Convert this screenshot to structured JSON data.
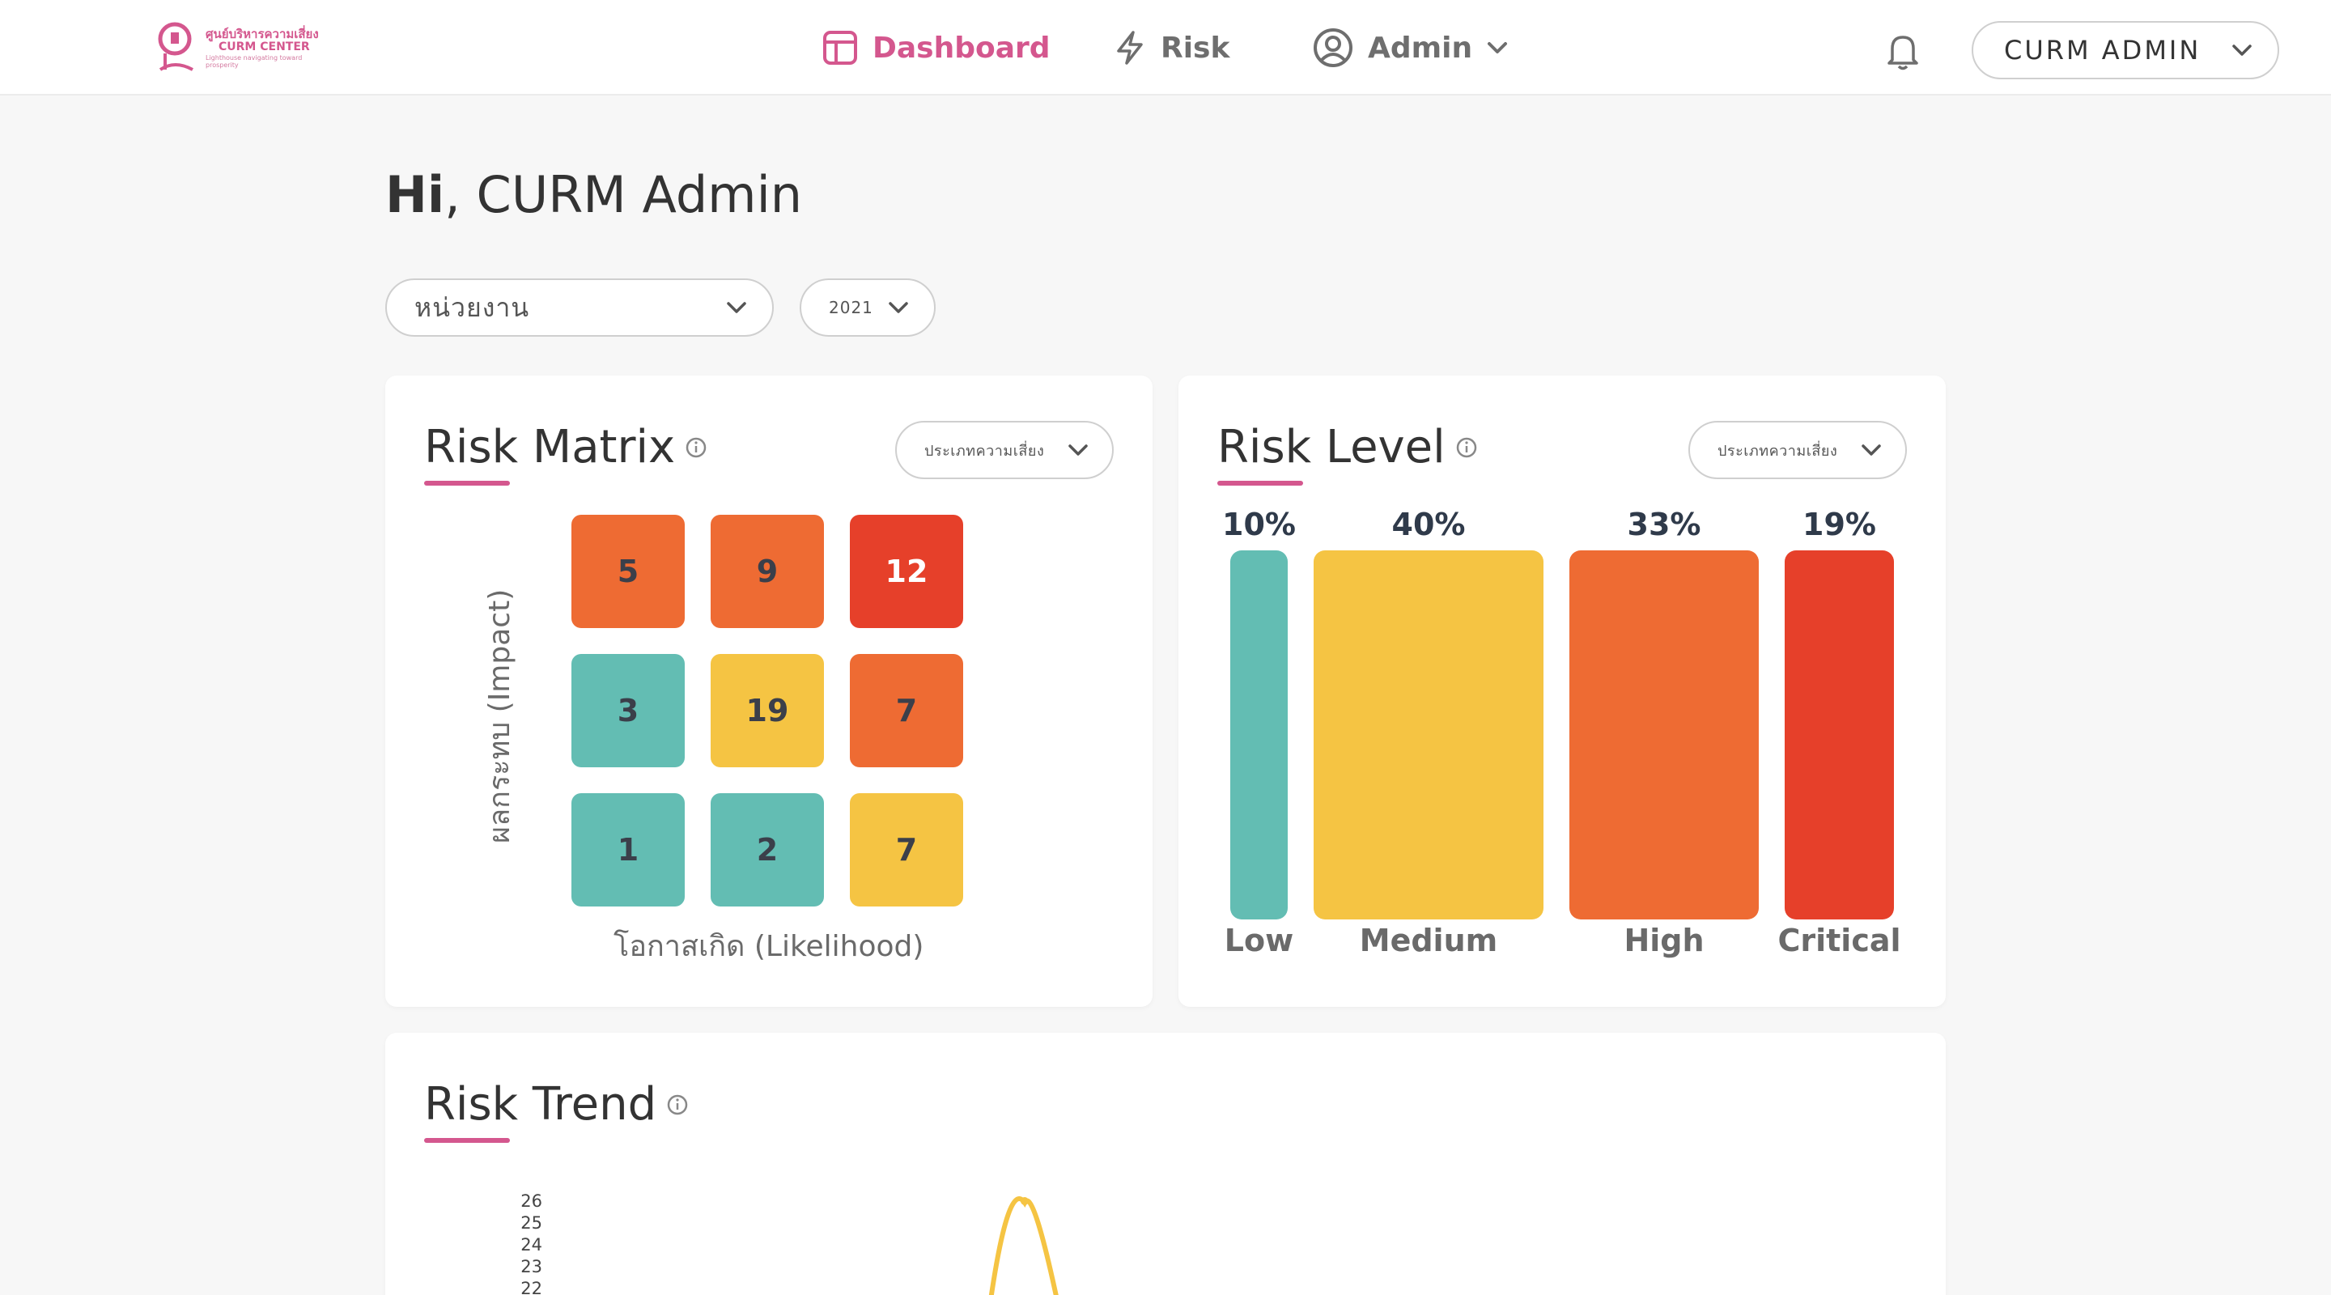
{
  "brand": {
    "logo_line1": "ศูนย์บริหารความเสี่ยง",
    "logo_line2": "CURM CENTER",
    "logo_line3": "Lighthouse navigating toward prosperity"
  },
  "nav": {
    "dashboard": "Dashboard",
    "risk": "Risk",
    "admin": "Admin"
  },
  "user_menu": {
    "label": "CURM ADMIN"
  },
  "greeting": {
    "hi": "Hi",
    "name": ", CURM Admin"
  },
  "filters": {
    "department": "หน่วยงาน",
    "year": "2021"
  },
  "risk_matrix": {
    "title": "Risk Matrix",
    "type_select": "ประเภทความเสี่ยง",
    "y_axis": "ผลกระทบ (Impact)",
    "x_axis": "โอกาสเกิด (Likelihood)",
    "rows": [
      [
        {
          "value": "5",
          "color": "#ee6b33"
        },
        {
          "value": "9",
          "color": "#ee6b33"
        },
        {
          "value": "12",
          "color": "#e6402a"
        }
      ],
      [
        {
          "value": "3",
          "color": "#63bdb3"
        },
        {
          "value": "19",
          "color": "#f5c443"
        },
        {
          "value": "7",
          "color": "#ee6b33"
        }
      ],
      [
        {
          "value": "1",
          "color": "#63bdb3"
        },
        {
          "value": "2",
          "color": "#63bdb3"
        },
        {
          "value": "7",
          "color": "#f5c443"
        }
      ]
    ]
  },
  "risk_level": {
    "title": "Risk Level",
    "type_select": "ประเภทความเสี่ยง",
    "levels": [
      {
        "label": "Low",
        "percent": "10%",
        "color": "#63bdb3"
      },
      {
        "label": "Medium",
        "percent": "40%",
        "color": "#f5c443"
      },
      {
        "label": "High",
        "percent": "33%",
        "color": "#ee6b33"
      },
      {
        "label": "Critical",
        "percent": "19%",
        "color": "#e6402a"
      }
    ]
  },
  "risk_trend": {
    "title": "Risk Trend",
    "y_ticks": [
      "26",
      "25",
      "24",
      "23",
      "22"
    ],
    "line_color": "#f5c443",
    "peak_value": 26
  },
  "colors": {
    "accent": "#d4578e",
    "low": "#63bdb3",
    "medium": "#f5c443",
    "high": "#ee6b33",
    "critical": "#e6402a"
  },
  "icons": {
    "dashboard": "layout-icon",
    "risk": "lightning-icon",
    "admin": "user-circle-icon",
    "bell": "bell-icon",
    "info": "info-icon",
    "chevron": "chevron-down-icon"
  }
}
